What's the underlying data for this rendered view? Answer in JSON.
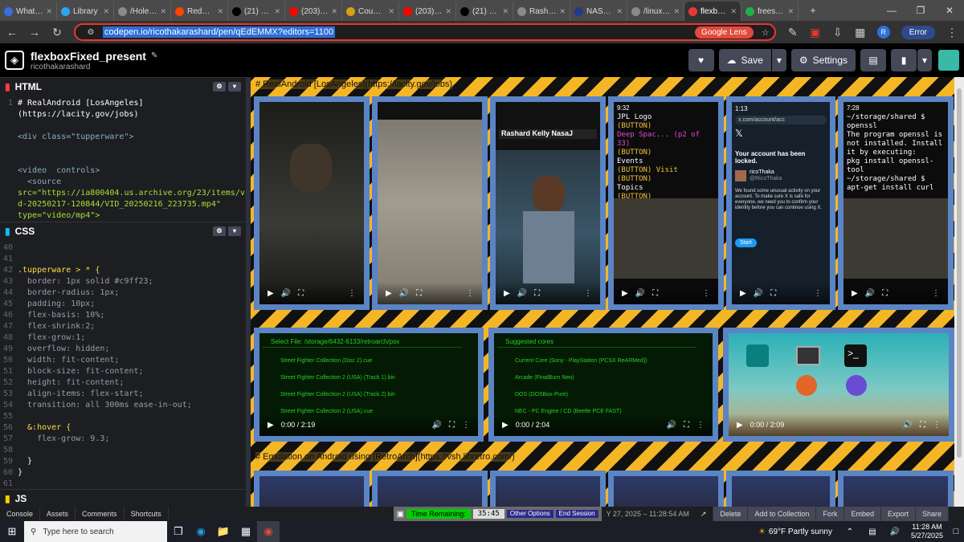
{
  "browser": {
    "tabs": [
      {
        "label": "What's N",
        "color": "#3b6ee0",
        "active": false
      },
      {
        "label": "Library",
        "color": "#2ea3f2",
        "active": false
      },
      {
        "label": "/HoleTo",
        "color": "#8a8a8a",
        "active": false
      },
      {
        "label": "Reddit -",
        "color": "#ff4500",
        "active": false
      },
      {
        "label": "(21) Bubl",
        "color": "#000000",
        "active": false
      },
      {
        "label": "(203) Lea",
        "color": "#ff0000",
        "active": false
      },
      {
        "label": "Council a",
        "color": "#d4a016",
        "active": false
      },
      {
        "label": "(203) DE",
        "color": "#ff0000",
        "active": false
      },
      {
        "label": "(21) Bubl",
        "color": "#000000",
        "active": false
      },
      {
        "label": "Rashard",
        "color": "#8a8a8a",
        "active": false
      },
      {
        "label": "NASA W",
        "color": "#1f3b8c",
        "active": false
      },
      {
        "label": "/linux | r",
        "color": "#8a8a8a",
        "active": false
      },
      {
        "label": "flexboxF",
        "color": "#e53935",
        "active": true
      },
      {
        "label": "freespac",
        "color": "#20b04a",
        "active": false
      }
    ],
    "new_tab": "+",
    "url": "codepen.io/ricothakarashard/pen/qEdEMMX?editors=1100",
    "google_lens": "Google Lens",
    "profile_initial": "R",
    "error_label": "Error"
  },
  "codepen": {
    "title": "flexboxFixed_present",
    "author": "ricothakarashard",
    "save_label": "Save",
    "settings_label": "Settings"
  },
  "editors": {
    "html_title": "HTML",
    "css_title": "CSS",
    "js_title": "JS"
  },
  "html_code": [
    {
      "n": "1",
      "t": "# RealAndroid [LosAngeles]"
    },
    {
      "n": "",
      "t": "(https://lacity.gov/jobs)"
    },
    {
      "n": "",
      "t": ""
    },
    {
      "n": "",
      "t": "<div class=\"tupperware\">"
    },
    {
      "n": "",
      "t": ""
    },
    {
      "n": "",
      "t": ""
    },
    {
      "n": "",
      "t": "<video  controls>"
    },
    {
      "n": "",
      "t": "  <source"
    },
    {
      "n": "",
      "t": "src=\"https://ia800404.us.archive.org/23/items/vi"
    },
    {
      "n": "",
      "t": "d-20250217-120844/VID_20250216_223735.mp4\""
    },
    {
      "n": "",
      "t": "type=\"video/mp4\">"
    }
  ],
  "css_code": [
    {
      "n": "40",
      "t": ""
    },
    {
      "n": "41",
      "t": ""
    },
    {
      "n": "42",
      "t": ".tupperware > * {"
    },
    {
      "n": "43",
      "t": "  border: 1px solid #c9ff23;"
    },
    {
      "n": "44",
      "t": "  border-radius: 1px;"
    },
    {
      "n": "45",
      "t": "  padding: 10px;"
    },
    {
      "n": "46",
      "t": "  flex-basis: 10%;"
    },
    {
      "n": "47",
      "t": "  flex-shrink:2;"
    },
    {
      "n": "48",
      "t": "  flex-grow:1;"
    },
    {
      "n": "49",
      "t": "  overflow: hidden;"
    },
    {
      "n": "50",
      "t": "  width: fit-content;"
    },
    {
      "n": "51",
      "t": "  block-size: fit-content;"
    },
    {
      "n": "52",
      "t": "  height: fit-content;"
    },
    {
      "n": "53",
      "t": "  align-items: flex-start;"
    },
    {
      "n": "54",
      "t": "  transition: all 300ms ease-in-out;"
    },
    {
      "n": "55",
      "t": ""
    },
    {
      "n": "56",
      "t": "  &:hover {"
    },
    {
      "n": "57",
      "t": "    flex-grow: 9.3;"
    },
    {
      "n": "58",
      "t": ""
    },
    {
      "n": "59",
      "t": "  }"
    },
    {
      "n": "60",
      "t": "}"
    },
    {
      "n": "61",
      "t": ""
    }
  ],
  "preview": {
    "heading1": "# RealAndroid [LosAngeles](https://lacity.gov/jobs)",
    "heading2": "# Emulation on Android using [RetroArch](https://vsh.libretro.com/)",
    "term1": [
      "JPL Logo",
      "(BUTTON)",
      "Deep Spac... (p2 of 33)",
      "(BUTTON)",
      "Events",
      "(BUTTON) Visit",
      "(BUTTON)",
      "Topics",
      "(BUTTON)"
    ],
    "term2": [
      "~/storage/shared $ openssl",
      "The program openssl is not installed. Install it by executing:",
      " pkg install openssl-tool",
      "~/storage/shared $ apt-get install curl"
    ],
    "locked_title": "Your account has been locked.",
    "locked_user": "ricoThaka",
    "locked_handle": "@RicoThaka",
    "locked_url": "x.com/account/acc",
    "locked_body": "We found some unusual activity on your account. To make sure X is safe for everyone, we need you to confirm your identity before you can continue using X.",
    "locked_start": "Start",
    "retro1_title": "Select File: /storage/6432-6133/retroarch/psx",
    "retro1_items": [
      "Street Fighter Collection (Disc 2).cue",
      "Street Fighter Collection 2 (USA) (Track 1).bin",
      "Street Fighter Collection 2 (USA) (Track 2).bin",
      "Street Fighter Collection 2 (USA).cue"
    ],
    "retro2_title": "Suggested cores",
    "retro2_items": [
      "Current Core (Sony - PlayStation (PCSX ReARMed))",
      "Arcade (FinalBurn Neo)",
      "DOS (DOSBox-Pure)",
      "NEC - PC Engine / CD (Beetle PCE FAST)"
    ],
    "time1": "0:00 / 2:19",
    "time2": "0:00 / 2:04",
    "time3": "0:00 / 2:09",
    "status1": "9:32",
    "status2": "1:13",
    "status3": "7:28"
  },
  "statusbar": {
    "console": "Console",
    "assets": "Assets",
    "comments": "Comments",
    "shortcuts": "Shortcuts",
    "time_label": "Time Remaining:",
    "time_value": "35:45",
    "other_options": "Other Options",
    "end_session": "End Session",
    "date": "Y 27, 2025 – 11:28:54 AM",
    "delete": "Delete",
    "add_collection": "Add to Collection",
    "fork": "Fork",
    "embed": "Embed",
    "export": "Export",
    "share": "Share"
  },
  "taskbar": {
    "search_placeholder": "Type here to search",
    "weather": "69°F  Partly sunny",
    "time": "11:28 AM",
    "date": "5/27/2025"
  },
  "colors": {
    "stripe_yellow": "#f5b626",
    "frame_blue": "#5b84c4",
    "url_border": "#e53935"
  }
}
